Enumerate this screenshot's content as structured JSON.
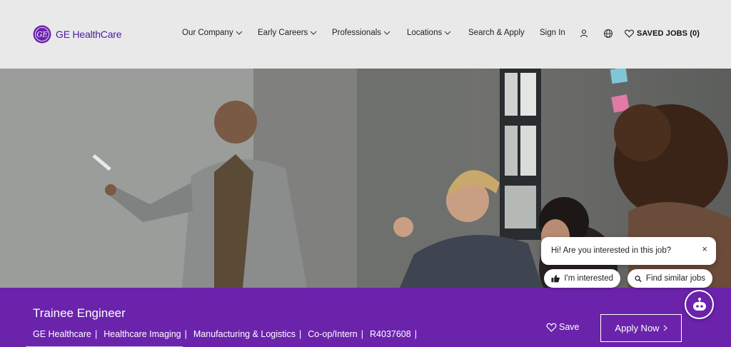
{
  "brand": {
    "logo_text": "GE HealthCare",
    "color": "#6b23ac"
  },
  "nav": {
    "items": [
      {
        "label": "Our Company",
        "has_menu": true
      },
      {
        "label": "Early Careers",
        "has_menu": true
      },
      {
        "label": "Professionals",
        "has_menu": true
      },
      {
        "label": "Locations",
        "has_menu": true
      },
      {
        "label": "Search & Apply",
        "has_menu": false
      },
      {
        "label": "Sign In",
        "has_menu": false
      }
    ],
    "icons": [
      "user-icon",
      "globe-icon"
    ],
    "saved_jobs": "SAVED JOBS (0)"
  },
  "hero": {
    "image": "office-meeting-photo"
  },
  "job": {
    "title": "Trainee Engineer",
    "meta": [
      "GE Healthcare",
      "Healthcare Imaging",
      "Manufacturing & Logistics",
      "Co-op/Intern",
      "R4037608"
    ],
    "save_label": "Save",
    "apply_label": "Apply Now"
  },
  "chat": {
    "question": "Hi! Are you interested in this job?",
    "close": "×",
    "chips": [
      "I'm interested",
      "Find similar jobs"
    ]
  }
}
